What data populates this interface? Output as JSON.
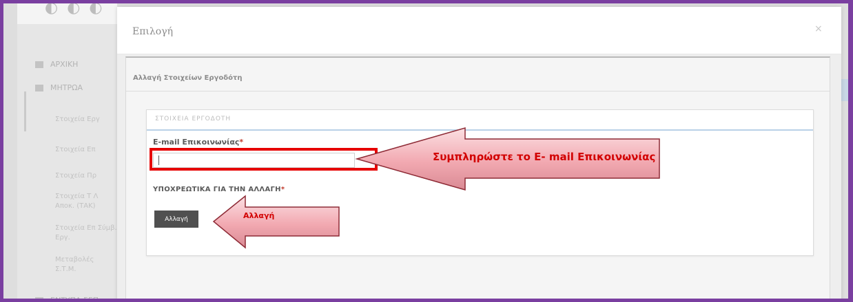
{
  "background": {
    "logo_text": "",
    "sidebar": {
      "items": [
        {
          "label": "ΑΡΧΙΚΗ"
        },
        {
          "label": "ΜΗΤΡΩΑ"
        },
        {
          "label": "ΕΝΤΥΠΑ ΣΕΠ"
        }
      ],
      "subitems": [
        "Στοιχεία Εργ",
        "Στοιχεία Επ",
        "Στοιχεία Πρ",
        "Στοιχεία Τ Λ Αποκ. (ΤΑΚ)",
        "Στοιχεία Επ Σύμβ. Εργ.",
        "Μεταβολές Σ.Τ.Μ."
      ]
    }
  },
  "modal": {
    "title": "Επιλογή",
    "close_label": "×",
    "panel_heading": "Αλλαγή Στοιχείων Εργοδότη",
    "section_title": "ΣΤΟΙΧΕΙΑ ΕΡΓΟΔΟΤΗ",
    "email_label": "E-mail Επικοινωνίας",
    "email_value": "",
    "email_placeholder": "",
    "required_mark": "*",
    "confirm_label": "ΥΠΟΧΡΕΩΤΙΚΑ ΓΙΑ ΤΗΝ ΑΛΛΑΓΗ",
    "change_button_label": "Αλλαγή"
  },
  "annotations": {
    "email_hint": "Συμπληρώστε το E- mail  Επικοινωνίας",
    "button_hint": "Αλλαγή"
  },
  "colors": {
    "frame_border": "#7a3fa0",
    "annotation_text": "#d20000",
    "highlight_box": "#e60000",
    "button_bg": "#505050"
  }
}
